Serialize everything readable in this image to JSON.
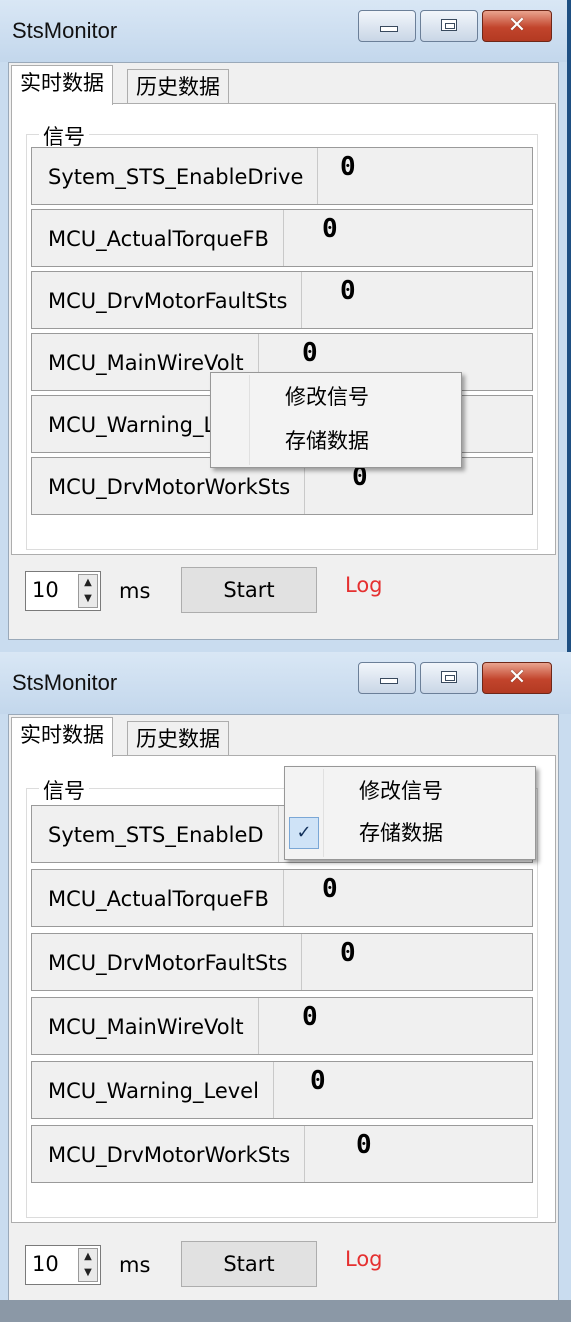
{
  "windows": [
    {
      "title": "StsMonitor",
      "tabs": [
        "实时数据",
        "历史数据"
      ],
      "group_label": "信号",
      "signals": [
        {
          "name": "Sytem_STS_EnableDrive",
          "value": "0"
        },
        {
          "name": "MCU_ActualTorqueFB",
          "value": "0"
        },
        {
          "name": "MCU_DrvMotorFaultSts",
          "value": "0"
        },
        {
          "name": "MCU_MainWireVolt",
          "value": "0"
        },
        {
          "name": "MCU_Warning_Level",
          "value": ""
        },
        {
          "name": "MCU_DrvMotorWorkSts",
          "value": "0"
        }
      ],
      "interval": "10",
      "unit": "ms",
      "start_label": "Start",
      "log_label": "Log",
      "context_menu": [
        {
          "label": "修改信号",
          "checked": false
        },
        {
          "label": "存储数据",
          "checked": false
        }
      ]
    },
    {
      "title": "StsMonitor",
      "tabs": [
        "实时数据",
        "历史数据"
      ],
      "group_label": "信号",
      "signals": [
        {
          "name": "Sytem_STS_EnableD",
          "value": ""
        },
        {
          "name": "MCU_ActualTorqueFB",
          "value": "0"
        },
        {
          "name": "MCU_DrvMotorFaultSts",
          "value": "0"
        },
        {
          "name": "MCU_MainWireVolt",
          "value": "0"
        },
        {
          "name": "MCU_Warning_Level",
          "value": "0"
        },
        {
          "name": "MCU_DrvMotorWorkSts",
          "value": "0"
        }
      ],
      "interval": "10",
      "unit": "ms",
      "start_label": "Start",
      "log_label": "Log",
      "context_menu": [
        {
          "label": "修改信号",
          "checked": false
        },
        {
          "label": "存储数据",
          "checked": true
        }
      ]
    }
  ],
  "icons": {
    "check": "checkmark-icon",
    "spin_up": "chevron-up-icon",
    "spin_down": "chevron-down-icon"
  }
}
